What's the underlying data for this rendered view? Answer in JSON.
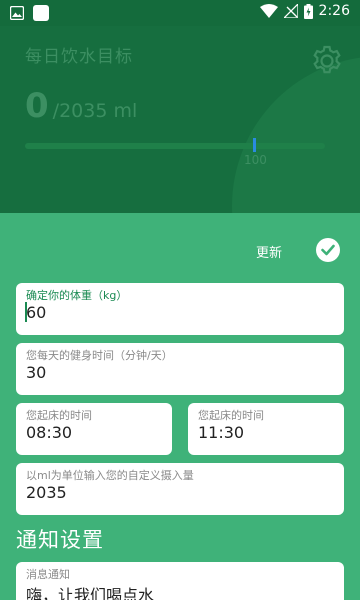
{
  "status_bar": {
    "time": "2:26",
    "icons": [
      "image-icon",
      "square-icon",
      "wifi-icon",
      "signal-off-icon",
      "battery-charging-icon"
    ]
  },
  "header": {
    "title": "每日饮水目标",
    "current": "0",
    "goal": "/2035 ml",
    "marker_label": "100",
    "progress_percent": 0
  },
  "actions": {
    "update_label": "更新"
  },
  "form": {
    "weight": {
      "label": "确定你的体重（kg）",
      "value": "60"
    },
    "exercise": {
      "label": "您每天的健身时间（分钟/天）",
      "value": "30"
    },
    "wake_time": {
      "label": "您起床的时间",
      "value": "08:30"
    },
    "sleep_time": {
      "label": "您起床的时间",
      "value": "11:30"
    },
    "custom_intake": {
      "label": "以ml为单位输入您的自定义摄入量",
      "value": "2035"
    }
  },
  "notifications": {
    "section_title": "通知设置",
    "message": {
      "label": "消息通知",
      "value": "嗨，让我们喝点水"
    }
  },
  "colors": {
    "header_bg": "#166e3f",
    "body_bg": "#3fb279",
    "status_bg": "#146b3c",
    "marker": "#2a8be0"
  }
}
